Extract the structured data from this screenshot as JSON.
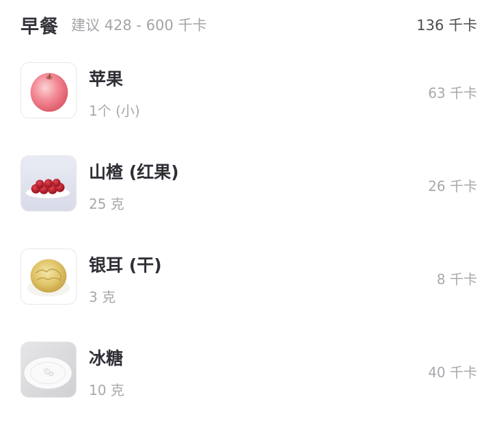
{
  "meal": {
    "title": "早餐",
    "suggestion": "建议 428 - 600 千卡",
    "total": "136 千卡"
  },
  "foods": [
    {
      "name": "苹果",
      "amount": "1个 (小)",
      "calories": "63 千卡",
      "icon": "apple-image"
    },
    {
      "name": "山楂 (红果)",
      "amount": "25 克",
      "calories": "26 千卡",
      "icon": "hawthorn-image"
    },
    {
      "name": "银耳 (干)",
      "amount": "3 克",
      "calories": "8 千卡",
      "icon": "white-fungus-image"
    },
    {
      "name": "冰糖",
      "amount": "10 克",
      "calories": "40 千卡",
      "icon": "rock-sugar-image"
    }
  ]
}
